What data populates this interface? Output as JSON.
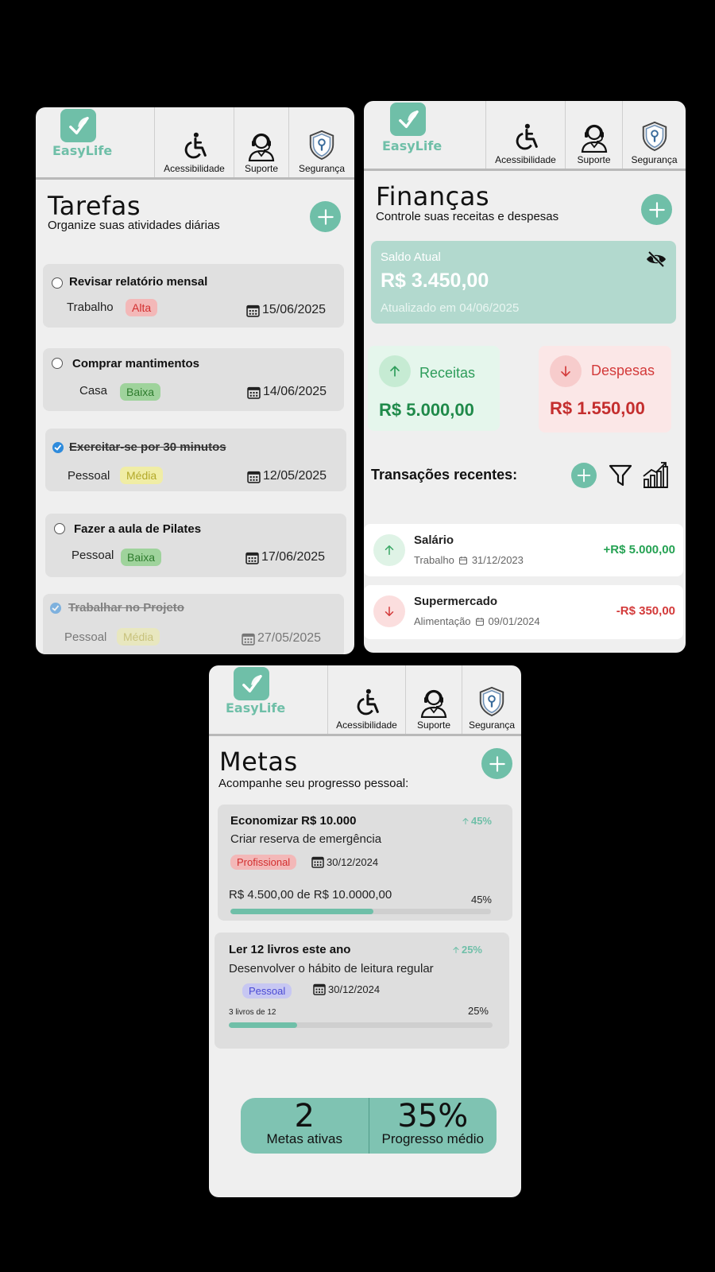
{
  "brand": {
    "name": "EasyLife",
    "accent": "#6fbfa8"
  },
  "nav": {
    "accessibility": "Acessibilidade",
    "support": "Suporte",
    "security": "Segurança"
  },
  "tasks": {
    "title": "Tarefas",
    "subtitle": "Organize suas atividades diárias",
    "items": [
      {
        "title": "Revisar relatório mensal",
        "category": "Trabalho",
        "priority": "Alta",
        "date": "15/06/2025",
        "done": false
      },
      {
        "title": "Comprar mantimentos",
        "category": "Casa",
        "priority": "Baixa",
        "date": "14/06/2025",
        "done": false
      },
      {
        "title": "Exercitar-se por 30 minutos",
        "category": "Pessoal",
        "priority": "Média",
        "date": "12/05/2025",
        "done": true
      },
      {
        "title": "Fazer a aula de Pilates",
        "category": "Pessoal",
        "priority": "Baixa",
        "date": "17/06/2025",
        "done": false
      },
      {
        "title": "Trabalhar no Projeto",
        "category": "Pessoal",
        "priority": "Média",
        "date": "27/05/2025",
        "done": true
      }
    ]
  },
  "finance": {
    "title": "Finanças",
    "subtitle": "Controle suas receitas e despesas",
    "balance_label": "Saldo Atual",
    "balance_value": "R$ 3.450,00",
    "updated": "Atualizado em 04/06/2025",
    "income_label": "Receitas",
    "income_value": "R$ 5.000,00",
    "expense_label": "Despesas",
    "expense_value": "R$ 1.550,00",
    "recent_title": "Transações recentes:",
    "transactions": [
      {
        "name": "Salário",
        "category": "Trabalho",
        "date": "31/12/2023",
        "amount": "+R$ 5.000,00",
        "type": "income"
      },
      {
        "name": "Supermercado",
        "category": "Alimentação",
        "date": "09/01/2024",
        "amount": "-R$ 350,00",
        "type": "expense"
      }
    ]
  },
  "goals": {
    "title": "Metas",
    "subtitle": "Acompanhe seu progresso pessoal:",
    "items": [
      {
        "title": "Economizar R$ 10.000",
        "description": "Criar reserva de emergência",
        "trend": "45%",
        "category": "Profissional",
        "date": "30/12/2024",
        "progress_text": "R$ 4.500,00 de R$ 10.0000,00",
        "percent_label": "45%",
        "progress": 0.55
      },
      {
        "title": "Ler 12 livros este ano",
        "description": "Desenvolver o hábito de leitura regular",
        "trend": "25%",
        "category": "Pessoal",
        "date": "30/12/2024",
        "progress_text": "3 livros de 12",
        "percent_label": "25%",
        "progress": 0.26
      }
    ],
    "active_count": "2",
    "active_label": "Metas ativas",
    "avg_progress": "35%",
    "avg_label": "Progresso médio"
  }
}
